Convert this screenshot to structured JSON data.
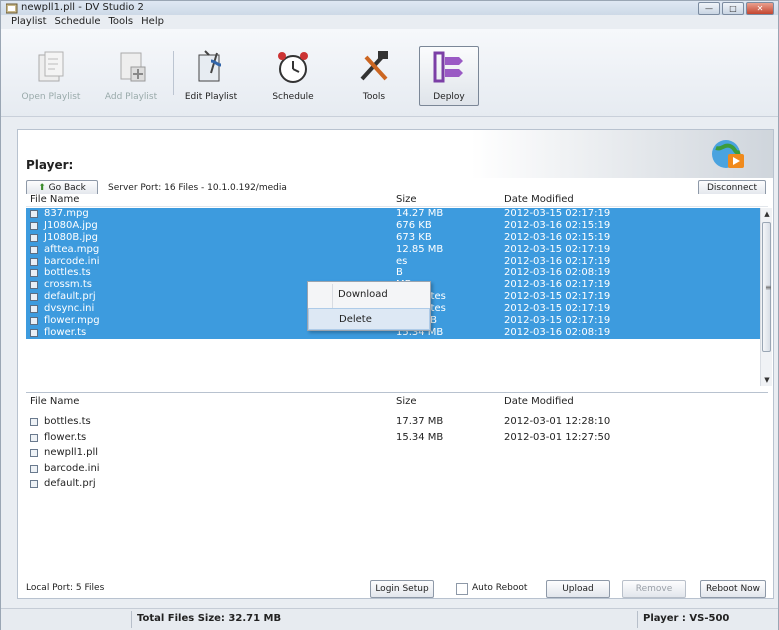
{
  "window": {
    "title": "newpll1.pll - DV Studio 2"
  },
  "menu": [
    "Playlist",
    "Schedule",
    "Tools",
    "Help"
  ],
  "toolbar": {
    "open_playlist": "Open Playlist",
    "add_playlist": "Add Playlist",
    "edit_playlist": "Edit Playlist",
    "schedule": "Schedule",
    "tools": "Tools",
    "deploy": "Deploy"
  },
  "player": {
    "title": "Player:",
    "go_back": "Go Back",
    "server_info": "Server Port: 16 Files - 10.1.0.192/media",
    "disconnect": "Disconnect",
    "columns": {
      "name": "File Name",
      "size": "Size",
      "date": "Date Modified"
    },
    "files": [
      {
        "name": "837.mpg",
        "size": "14.27 MB",
        "date": "2012-03-15 02:17:19"
      },
      {
        "name": "J1080A.jpg",
        "size": "676 KB",
        "date": "2012-03-16 02:15:19"
      },
      {
        "name": "J1080B.jpg",
        "size": "673 KB",
        "date": "2012-03-16 02:15:19"
      },
      {
        "name": "afttea.mpg",
        "size": "12.85 MB",
        "date": "2012-03-15 02:17:19"
      },
      {
        "name": "barcode.ini",
        "size": "es",
        "date": "2012-03-16 02:17:19"
      },
      {
        "name": "bottles.ts",
        "size": "B",
        "date": "2012-03-16 02:08:19"
      },
      {
        "name": "crossm.ts",
        "size": "MB",
        "date": "2012-03-16 02:17:19"
      },
      {
        "name": "default.prj",
        "size": "174 bytes",
        "date": "2012-03-15 02:17:19"
      },
      {
        "name": "dvsync.ini",
        "size": "492 bytes",
        "date": "2012-03-15 02:17:19"
      },
      {
        "name": "flower.mpg",
        "size": "1.81 MB",
        "date": "2012-03-15 02:17:19"
      },
      {
        "name": "flower.ts",
        "size": "15.34 MB",
        "date": "2012-03-16 02:08:19"
      }
    ],
    "context_menu": [
      "Download",
      "Delete"
    ]
  },
  "local": {
    "columns": {
      "name": "File Name",
      "size": "Size",
      "date": "Date Modified"
    },
    "files": [
      {
        "name": "bottles.ts",
        "size": "17.37 MB",
        "date": "2012-03-01 12:28:10"
      },
      {
        "name": "flower.ts",
        "size": "15.34 MB",
        "date": "2012-03-01 12:27:50"
      },
      {
        "name": "newpll1.pll",
        "size": "",
        "date": ""
      },
      {
        "name": "barcode.ini",
        "size": "",
        "date": ""
      },
      {
        "name": "default.prj",
        "size": "",
        "date": ""
      }
    ],
    "local_port": "Local Port: 5 Files",
    "login_setup": "Login Setup",
    "auto_reboot": "Auto Reboot",
    "upload": "Upload",
    "remove": "Remove",
    "reboot_now": "Reboot Now"
  },
  "status": {
    "total_size": "Total Files Size: 32.71 MB",
    "player": "Player : VS-500"
  }
}
